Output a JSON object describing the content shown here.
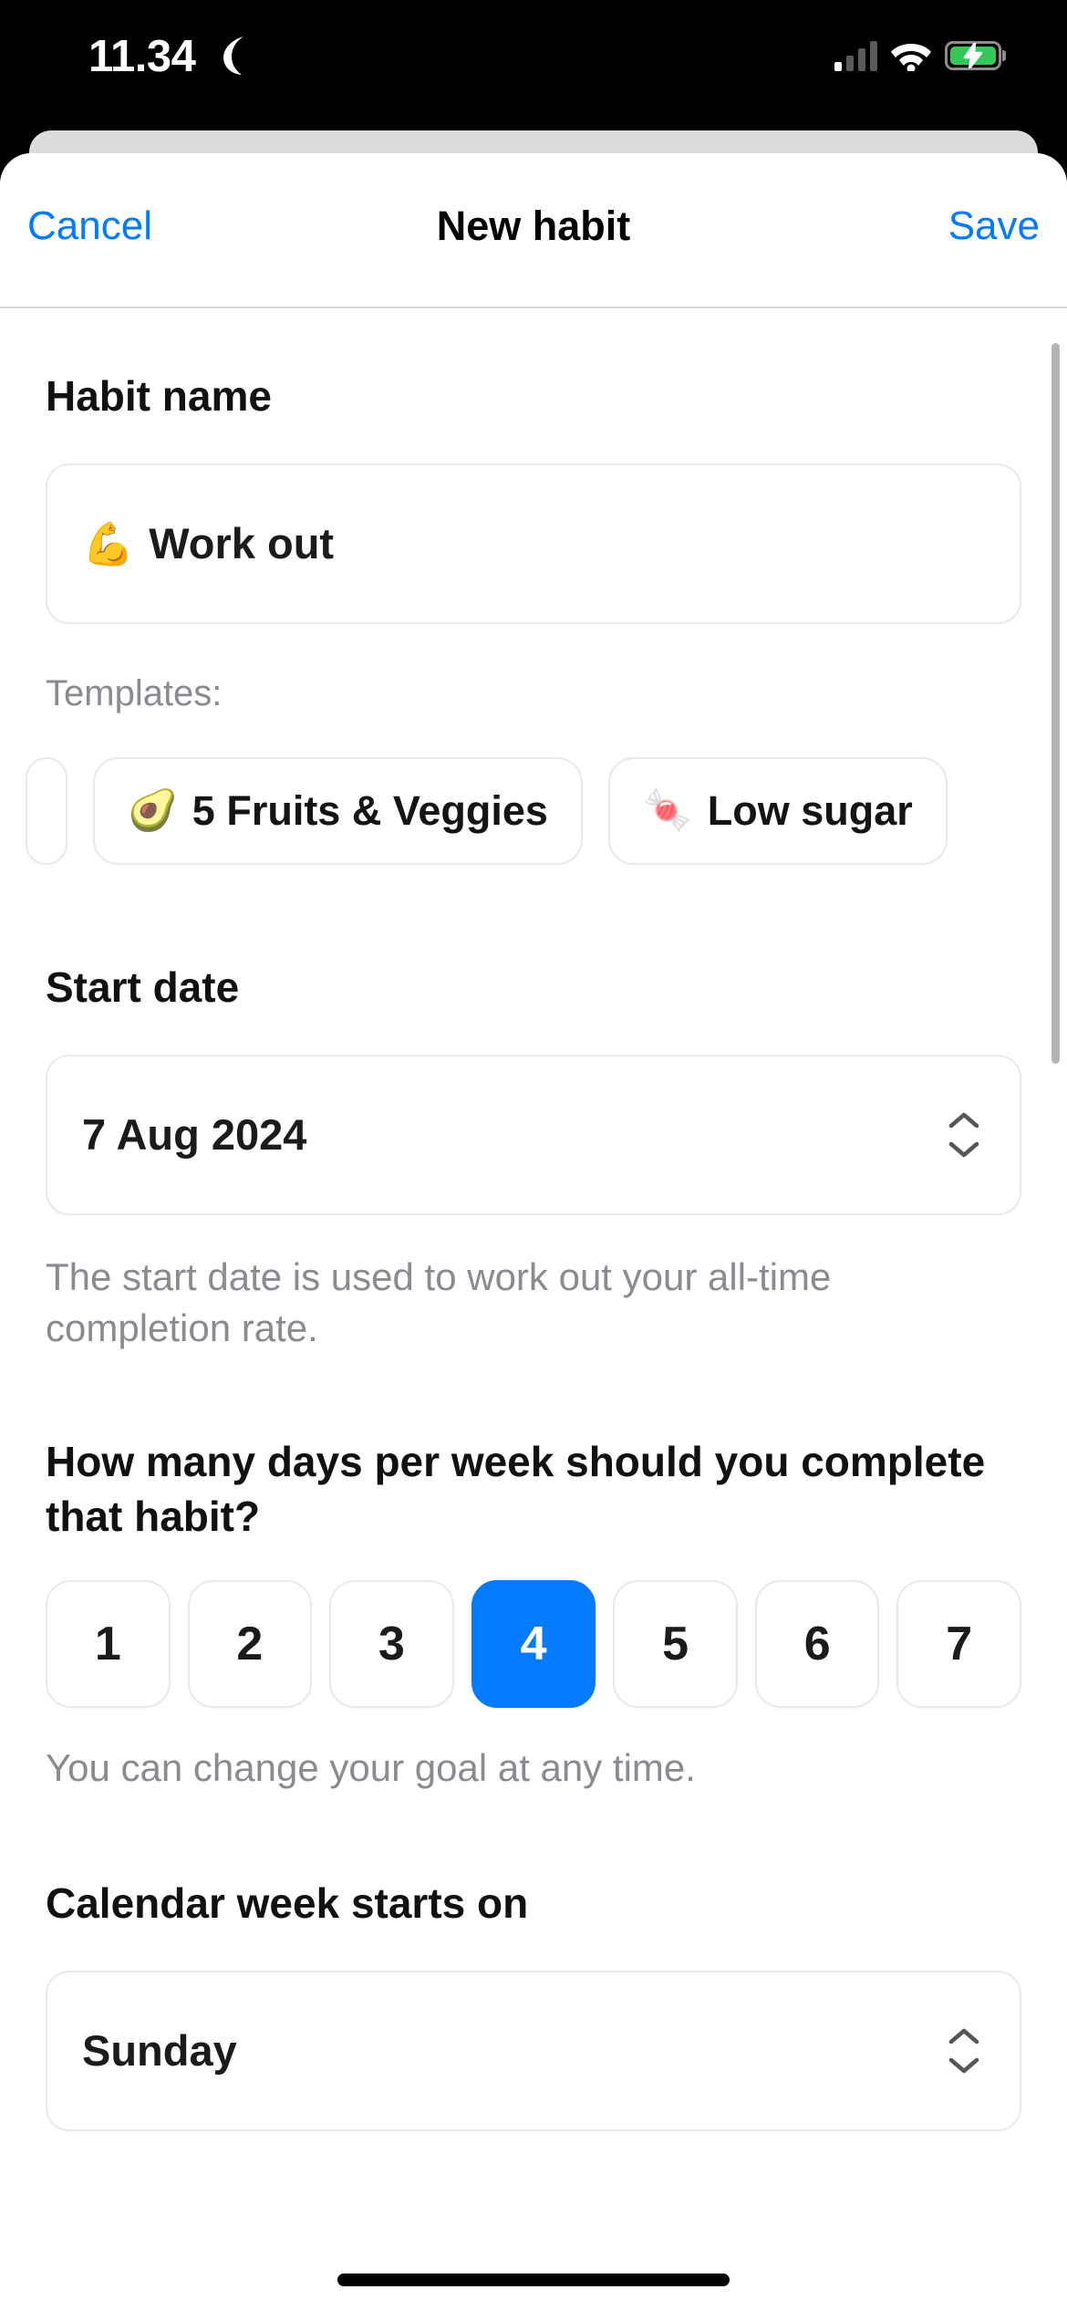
{
  "status_bar": {
    "time": "11.34",
    "dnd_icon": "crescent-moon-icon",
    "cellular_icon": "cellular-signal-icon",
    "cellular_bars_active": 1,
    "cellular_bars_total": 4,
    "wifi_icon": "wifi-icon",
    "battery_icon": "battery-charging-icon",
    "battery_color": "#34c759"
  },
  "nav_bar": {
    "cancel_label": "Cancel",
    "title": "New habit",
    "save_label": "Save",
    "accent_color": "#047aff"
  },
  "habit_name": {
    "heading": "Habit name",
    "value": "Work out",
    "emoji": "💪",
    "placeholder": "Habit name"
  },
  "templates": {
    "label": "Templates:",
    "items": [
      {
        "emoji": "",
        "label": ""
      },
      {
        "emoji": "🥑",
        "label": "5 Fruits & Veggies"
      },
      {
        "emoji": "🍬",
        "label": "Low sugar"
      }
    ]
  },
  "start_date": {
    "heading": "Start date",
    "value": "7 Aug 2024",
    "stepper_icon": "chevron-up-down-icon",
    "help_text": "The start date is used to work out your all-time completion rate."
  },
  "days_per_week": {
    "question": "How many days per week should you complete that habit?",
    "options": [
      "1",
      "2",
      "3",
      "4",
      "5",
      "6",
      "7"
    ],
    "selected": "4",
    "selected_color": "#047aff",
    "help_text": "You can change your goal at any time."
  },
  "week_start": {
    "heading": "Calendar week starts on",
    "value": "Sunday",
    "stepper_icon": "chevron-up-down-icon"
  },
  "home_indicator": "home-indicator"
}
